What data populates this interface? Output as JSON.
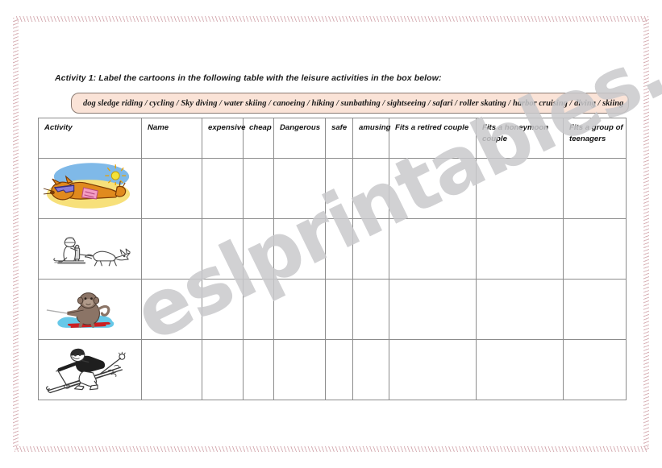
{
  "worksheet": {
    "instruction": "Activity 1: Label the cartoons in the following table with the leisure activities in the box below:",
    "word_box": "dog sledge riding / cycling / Sky diving / water skiing / canoeing / hiking / sunbathing / sightseeing / safari / roller skating / harbor cruising / diving / skiing",
    "watermark": "eslprintables.com"
  },
  "table": {
    "headers": [
      "Activity",
      "Name",
      "expensive",
      "cheap",
      "Dangerous",
      "safe",
      "amusing",
      "Fits a retired couple",
      "Fits a honeymoon couple",
      "Fits a group of teenagers"
    ],
    "rows": [
      {
        "picture": "sunbathing-cartoon",
        "cells": [
          "",
          "",
          "",
          "",
          "",
          "",
          "",
          "",
          ""
        ]
      },
      {
        "picture": "dog-sledge-riding-cartoon",
        "cells": [
          "",
          "",
          "",
          "",
          "",
          "",
          "",
          "",
          ""
        ]
      },
      {
        "picture": "water-skiing-cartoon",
        "cells": [
          "",
          "",
          "",
          "",
          "",
          "",
          "",
          "",
          ""
        ]
      },
      {
        "picture": "skiing-cartoon",
        "cells": [
          "",
          "",
          "",
          "",
          "",
          "",
          "",
          "",
          ""
        ]
      }
    ]
  },
  "colors": {
    "word_box_fill": "#fae3d7",
    "word_box_border": "#8a7b73",
    "table_border": "#8c8c8c",
    "page_border": "#d9b3b8",
    "watermark": "#c9c9cc"
  }
}
